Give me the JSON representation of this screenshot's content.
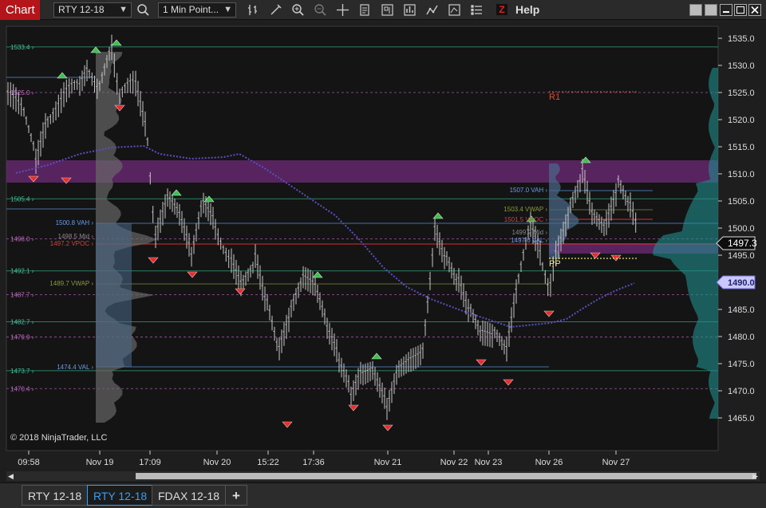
{
  "toolbar": {
    "chart_label": "Chart",
    "instrument": "RTY 12-18",
    "interval": "1 Min Point...",
    "help_label": "Help",
    "z_label": "Z"
  },
  "chart": {
    "copyright": "© 2018 NinjaTrader, LLC",
    "price_axis": [
      "1535.0",
      "1530.0",
      "1525.0",
      "1520.0",
      "1515.0",
      "1510.0",
      "1505.0",
      "1500.0",
      "1495.0",
      "1490.0",
      "1485.0",
      "1480.0",
      "1475.0",
      "1470.0",
      "1465.0"
    ],
    "last_price": "1497.3",
    "crosshair_price": "1490.0",
    "time_axis": [
      "09:58",
      "Nov 19",
      "17:09",
      "Nov 20",
      "15:22",
      "17:36",
      "Nov 21",
      "Nov 22",
      "Nov 23",
      "Nov 26",
      "Nov 27"
    ],
    "left_levels": [
      "1533.4",
      "1525.0",
      "1505.4",
      "1498.0",
      "1492.1",
      "1487.7",
      "1482.7",
      "1479.9",
      "1473.7",
      "1470.4"
    ],
    "profile_left_labels": [
      "1500.8 VAH",
      "1498.5 Mid",
      "1497.2 VPOC",
      "1489.7 VWAP",
      "1474.4 VAL"
    ],
    "profile_right_labels": [
      "1507.0 VAH",
      "1503.4 VWAP",
      "1501.5 VPOC",
      "1499.2 Mid",
      "1497.6 VAL"
    ],
    "pivot_r1": "R1",
    "pivot_pp": "PP"
  },
  "tabs": {
    "items": [
      {
        "label": "RTY 12-18"
      },
      {
        "label": "RTY 12-18"
      },
      {
        "label": "FDAX 12-18"
      }
    ],
    "add": "+"
  },
  "colors": {
    "accent": "#b3151b",
    "active_tab": "#3d9cf0",
    "value_area_band": "#6d2a78",
    "trend_line": "#5a4fc0"
  }
}
